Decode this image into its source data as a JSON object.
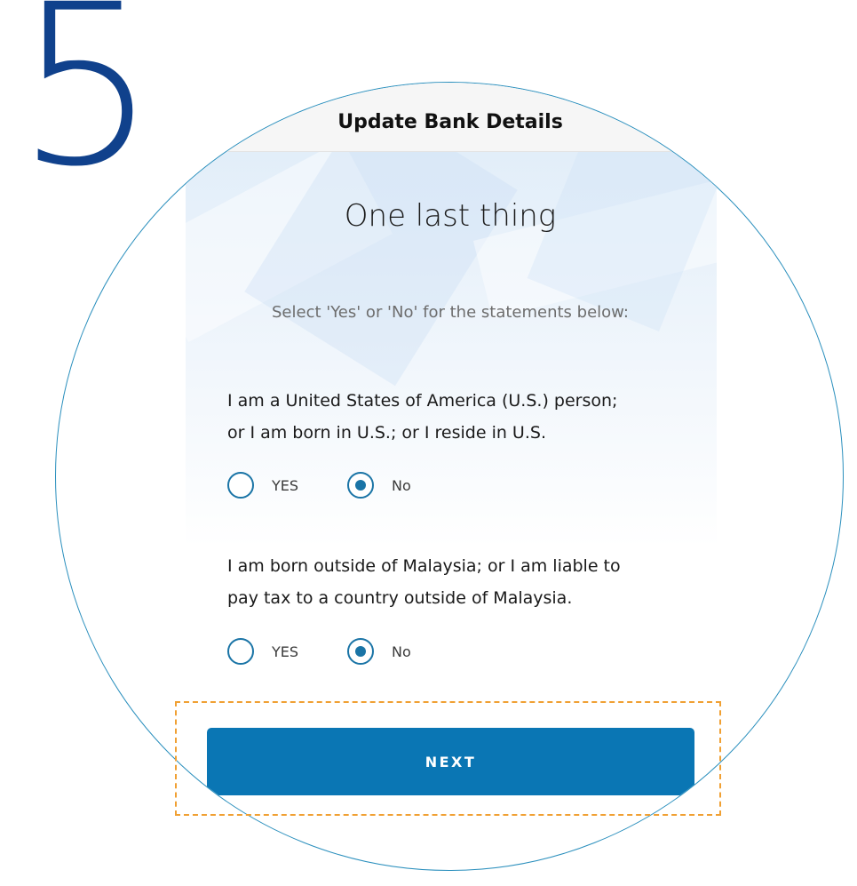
{
  "step": {
    "number": "5",
    "color": "#10418c"
  },
  "header": {
    "title": "Update Bank Details"
  },
  "main": {
    "headline": "One last thing",
    "instruction": "Select 'Yes' or 'No' for the statements below:",
    "questions": [
      {
        "line1": "I am a United States of America (U.S.) person;",
        "line2": "or I am born in U.S.; or I reside in U.S.",
        "options": [
          {
            "label": "YES",
            "selected": false
          },
          {
            "label": "No",
            "selected": true
          }
        ]
      },
      {
        "line1": "I am born outside of Malaysia; or I am liable to",
        "line2": "pay tax to a country outside of Malaysia.",
        "options": [
          {
            "label": "YES",
            "selected": false
          },
          {
            "label": "No",
            "selected": true
          }
        ]
      }
    ],
    "next_label": "NEXT"
  },
  "colors": {
    "accent": "#0a76b4",
    "radio": "#1a74a6",
    "circle_outline": "#2a8fbd",
    "highlight": "#f0a033"
  }
}
